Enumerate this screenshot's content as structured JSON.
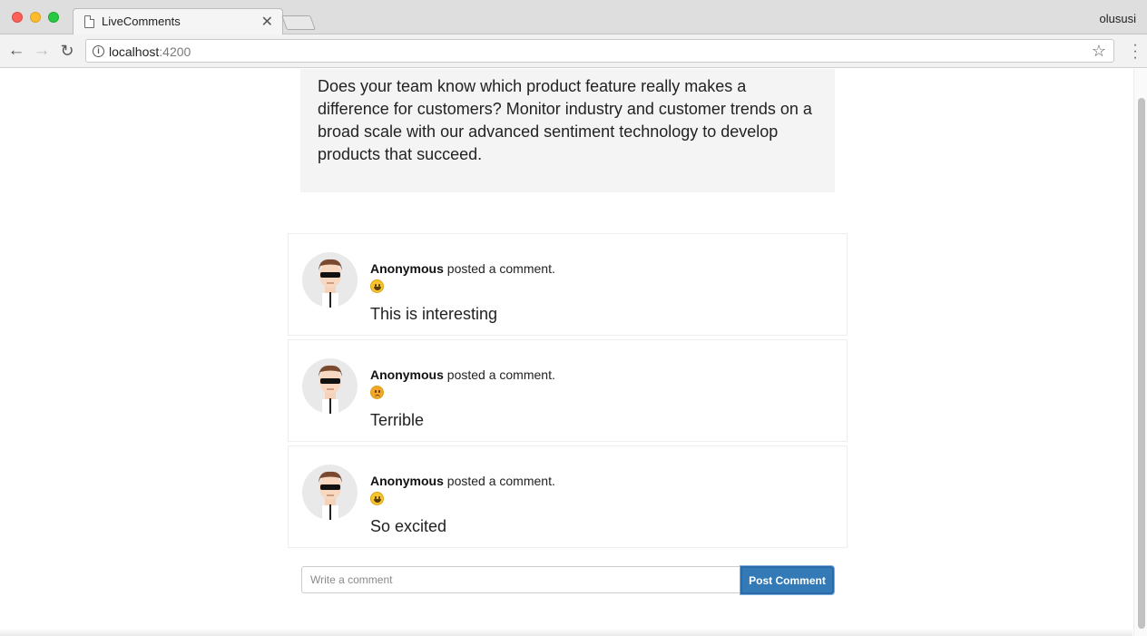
{
  "browser": {
    "tab_title": "LiveComments",
    "profile_name": "olususi",
    "url_host": "localhost",
    "url_port": ":4200"
  },
  "hero": {
    "text": "Does your team know which product feature really makes a difference for customers? Monitor industry and customer trends on a broad scale with our advanced sentiment technology to develop products that succeed."
  },
  "comments": [
    {
      "author": "Anonymous",
      "action": " posted a comment.",
      "sentiment_icon": "happy-emoji-icon",
      "body": "This is interesting"
    },
    {
      "author": "Anonymous",
      "action": " posted a comment.",
      "sentiment_icon": "angry-emoji-icon",
      "body": "Terrible"
    },
    {
      "author": "Anonymous",
      "action": " posted a comment.",
      "sentiment_icon": "happy-emoji-icon",
      "body": "So excited"
    }
  ],
  "form": {
    "placeholder": "Write a comment",
    "value": "",
    "button_label": "Post Comment"
  },
  "colors": {
    "button": "#337ab7",
    "hero_background": "#f4f4f4"
  }
}
